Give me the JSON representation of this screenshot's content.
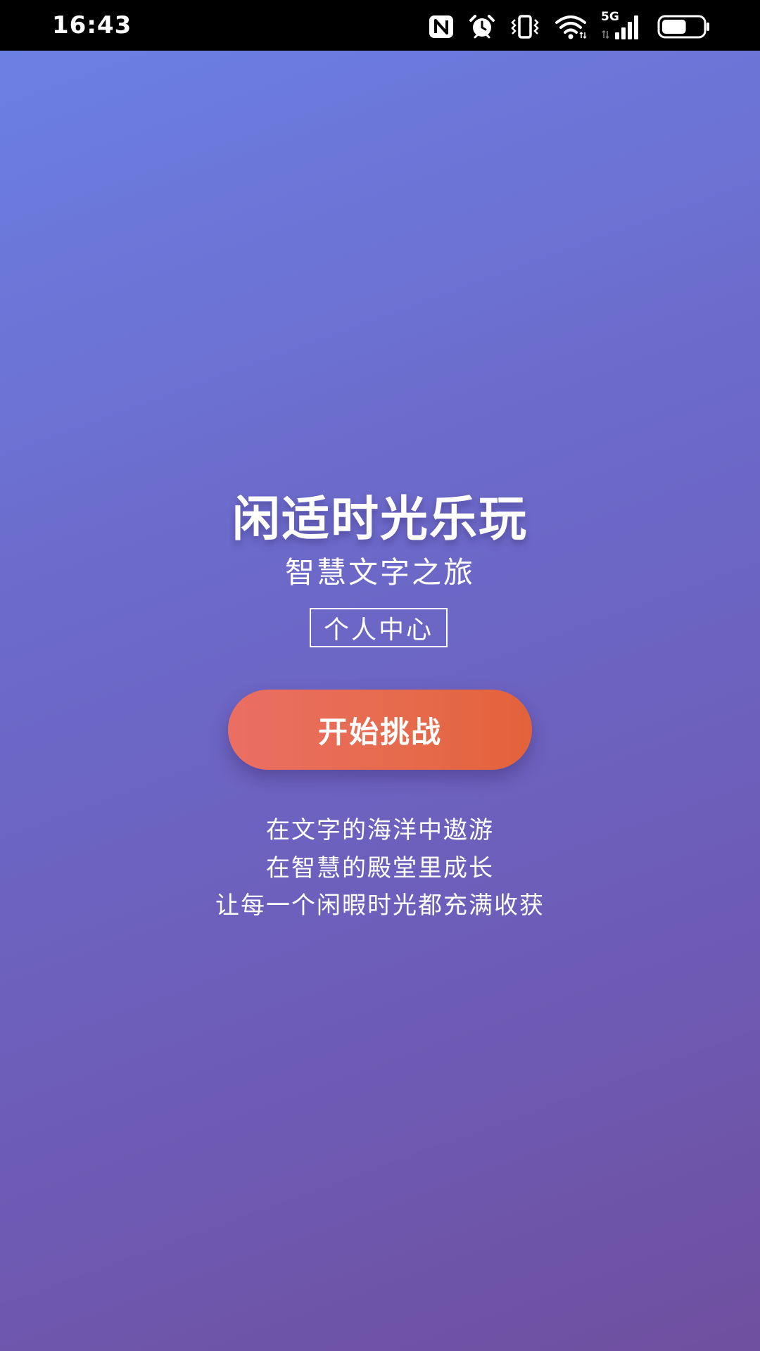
{
  "status_bar": {
    "time": "16:43",
    "network": "5G",
    "icons": [
      "nfc-icon",
      "alarm-icon",
      "vibrate-icon",
      "wifi-icon",
      "signal-icon",
      "battery-icon"
    ],
    "battery_level": 0.6
  },
  "home": {
    "title": "闲适时光乐玩",
    "subtitle": "智慧文字之旅",
    "personal_center_label": "个人中心",
    "start_button_label": "开始挑战",
    "taglines": [
      "在文字的海洋中遨游",
      "在智慧的殿堂里成长",
      "让每一个闲暇时光都充满收获"
    ]
  },
  "colors": {
    "background_top": "#6b80e3",
    "background_bottom": "#6f4f9f",
    "button_start": "#ea6f63",
    "button_end": "#e2623a",
    "text": "#ffffff"
  }
}
